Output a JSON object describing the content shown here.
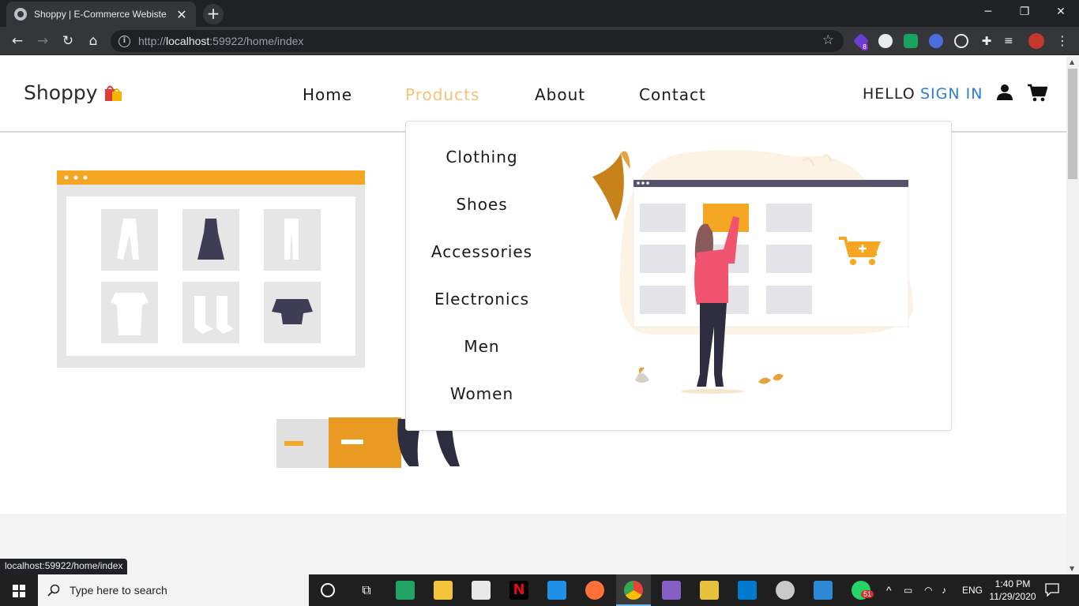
{
  "browser": {
    "tab_title": "Shoppy | E-Commerce Webiste",
    "tab_close": "✕",
    "newtab": "+",
    "url_prefix": "http://",
    "url_host": "localhost",
    "url_rest": ":59922/home/index",
    "ext_badge": "8",
    "status_url": "localhost:59922/home/index"
  },
  "site": {
    "brand": "Shoppy",
    "nav": [
      "Home",
      "Products",
      "About",
      "Contact"
    ],
    "hello": "HELLO",
    "signin": "SIGN IN",
    "accent": "#f5c27a",
    "link_color": "#2d7dd2"
  },
  "dropdown": {
    "items": [
      "Clothing",
      "Shoes",
      "Accessories",
      "Electronics",
      "Men",
      "Women"
    ]
  },
  "taskbar": {
    "search_placeholder": "Type here to search",
    "whatsapp_badge": "51",
    "lang": "ENG",
    "time": "1:40 PM",
    "date": "11/29/2020"
  }
}
